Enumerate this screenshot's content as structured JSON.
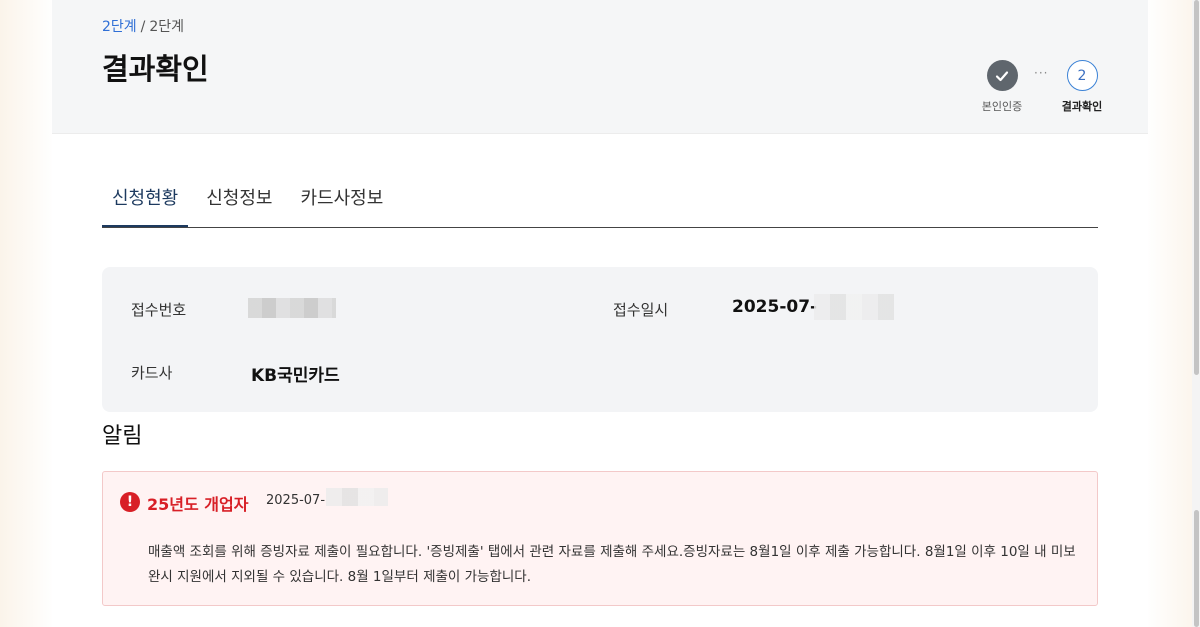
{
  "breadcrumb": {
    "current": "2단계",
    "separator": "/",
    "step": "2단계"
  },
  "page_title": "결과확인",
  "stepper": {
    "steps": [
      {
        "label": "본인인증",
        "state": "done"
      },
      {
        "label": "결과확인",
        "number": "2",
        "state": "active"
      }
    ],
    "dots": "···"
  },
  "tabs": [
    {
      "label": "신청현황",
      "active": true
    },
    {
      "label": "신청정보",
      "active": false
    },
    {
      "label": "카드사정보",
      "active": false
    }
  ],
  "application": {
    "receipt_number_label": "접수번호",
    "receipt_date_label": "접수일시",
    "receipt_date_value": "2025-07-",
    "card_company_label": "카드사",
    "card_company_value": "KB국민카드"
  },
  "notice_section_title": "알림",
  "notice": {
    "title": "25년도 개업자",
    "date": "2025-07-",
    "body": "매출액 조회를 위해 증빙자료 제출이 필요합니다. '증빙제출' 탭에서 관련 자료를 제출해 주세요.증빙자료는 8월1일 이후 제출 가능합니다. 8월1일 이후 10일 내 미보완시 지원에서 지외될 수 있습니다. 8월 1일부터 제출이 가능합니다."
  },
  "colors": {
    "accent_blue": "#2f6fd6",
    "alert_red": "#d81f26",
    "notice_bg": "#fff3f3",
    "tab_active": "#1d3a5f"
  },
  "icons": {
    "step_done": "check-icon",
    "notice": "alert-circle-icon"
  }
}
